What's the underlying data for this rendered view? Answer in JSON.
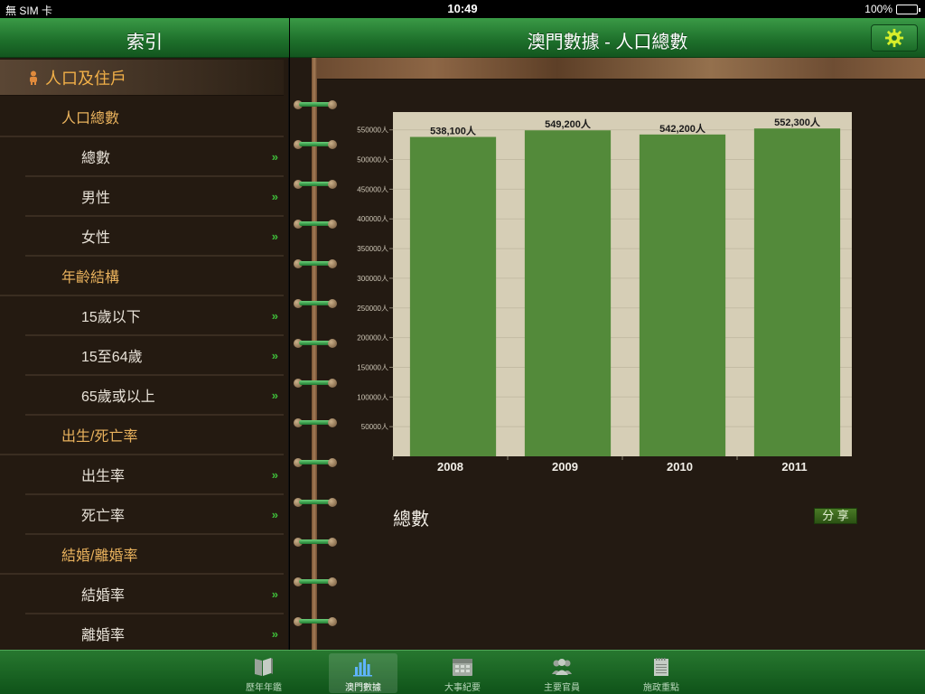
{
  "status": {
    "carrier": "無 SIM 卡",
    "time": "10:49",
    "battery": "100%"
  },
  "left_header": {
    "title": "索引"
  },
  "right_header": {
    "title": "澳門數據 - 人口總數"
  },
  "sidebar": {
    "section": "人口及住戶",
    "groups": [
      {
        "label": "人口總數",
        "items": [
          "總數",
          "男性",
          "女性"
        ]
      },
      {
        "label": "年齡結構",
        "items": [
          "15歲以下",
          "15至64歲",
          "65歲或以上"
        ]
      },
      {
        "label": "出生/死亡率",
        "items": [
          "出生率",
          "死亡率"
        ]
      },
      {
        "label": "結婚/離婚率",
        "items": [
          "結婚率",
          "離婚率"
        ]
      }
    ],
    "arrow": "»"
  },
  "content": {
    "caption": "總數",
    "share_label": "分 享"
  },
  "chart_data": {
    "type": "bar",
    "categories": [
      "2008",
      "2009",
      "2010",
      "2011"
    ],
    "values": [
      538100,
      549200,
      542200,
      552300
    ],
    "data_labels": [
      "538,100人",
      "549,200人",
      "542,200人",
      "552,300人"
    ],
    "ylim": [
      0,
      580000
    ],
    "yticks": [
      50000,
      100000,
      150000,
      200000,
      250000,
      300000,
      350000,
      400000,
      450000,
      500000,
      550000
    ],
    "ytick_labels": [
      "50000人",
      "100000人",
      "150000人",
      "200000人",
      "250000人",
      "300000人",
      "350000人",
      "400000人",
      "450000人",
      "500000人",
      "550000人"
    ],
    "bar_color": "#538a3a",
    "plot_bg": "#d6ceb6",
    "grid": true
  },
  "tabs": [
    {
      "label": "歷年年鑑",
      "icon": "book-icon",
      "active": false
    },
    {
      "label": "澳門數據",
      "icon": "bar-chart-icon",
      "active": true
    },
    {
      "label": "大事紀要",
      "icon": "calendar-icon",
      "active": false
    },
    {
      "label": "主要官員",
      "icon": "people-icon",
      "active": false
    },
    {
      "label": "施政重點",
      "icon": "notepad-icon",
      "active": false
    }
  ]
}
